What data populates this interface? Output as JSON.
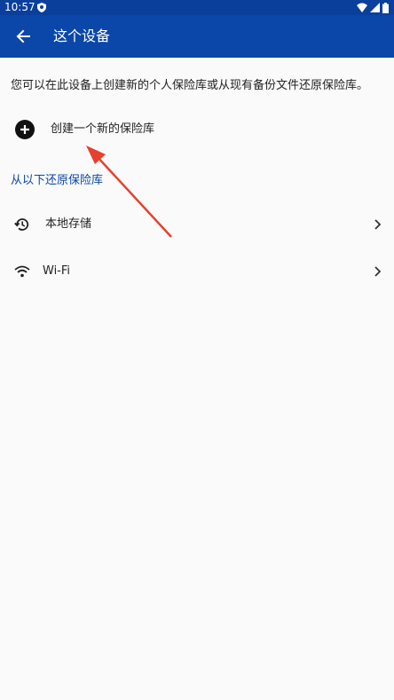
{
  "status_bar": {
    "time": "10:57",
    "icons": [
      "shield-icon",
      "wifi-signal-icon",
      "cell-signal-icon",
      "battery-icon"
    ]
  },
  "app_bar": {
    "back_icon": "arrow-left-icon",
    "title": "这个设备"
  },
  "description": "您可以在此设备上创建新的个人保险库或从现有备份文件还原保险库。",
  "create_vault": {
    "icon": "plus-circle-icon",
    "label": "创建一个新的保险库"
  },
  "restore_section": {
    "title": "从以下还原保险库",
    "items": [
      {
        "icon": "history-icon",
        "label": "本地存储",
        "trailing_icon": "chevron-right-icon"
      },
      {
        "icon": "wifi-icon",
        "label": "Wi-Fi",
        "trailing_icon": "chevron-right-icon"
      }
    ]
  },
  "colors": {
    "app_bar": "#0b47a8",
    "status_bar": "#0b3f9c",
    "accent_text": "#0b47a8",
    "background": "#fafafa",
    "annotation_arrow": "#e8402f"
  }
}
